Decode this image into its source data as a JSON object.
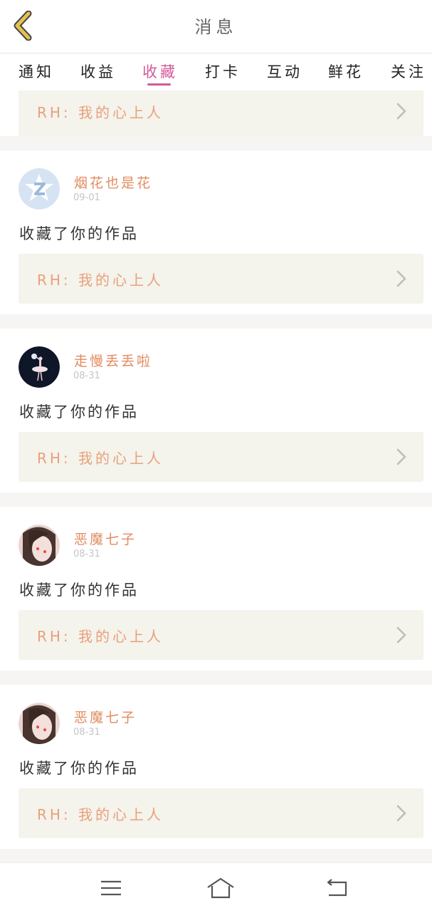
{
  "header": {
    "title": "消息",
    "back_icon": "back-chevron-icon"
  },
  "tabs": [
    {
      "label": "通知",
      "active": false
    },
    {
      "label": "收益",
      "active": false
    },
    {
      "label": "收藏",
      "active": true
    },
    {
      "label": "打卡",
      "active": false
    },
    {
      "label": "互动",
      "active": false
    },
    {
      "label": "鲜花",
      "active": false
    },
    {
      "label": "关注",
      "active": false
    }
  ],
  "colors": {
    "active_tab": "#d45a98",
    "username": "#e28b5f",
    "work_title": "#e9a07a",
    "back_icon": "#e4c250",
    "work_box_bg": "#f4f3ec"
  },
  "partial_item": {
    "work_title": "RH:  我的心上人"
  },
  "items": [
    {
      "username": "烟花也是花",
      "date": "09-01",
      "action": "收藏了你的作品",
      "work_title": "RH:  我的心上人",
      "avatar": "qq-default-avatar"
    },
    {
      "username": "走慢丢丢啦",
      "date": "08-31",
      "action": "收藏了你的作品",
      "work_title": "RH:  我的心上人",
      "avatar": "ballerina-avatar"
    },
    {
      "username": "恶魔七子",
      "date": "08-31",
      "action": "收藏了你的作品",
      "work_title": "RH:  我的心上人",
      "avatar": "girl-portrait-avatar"
    },
    {
      "username": "恶魔七子",
      "date": "08-31",
      "action": "收藏了你的作品",
      "work_title": "RH:  我的心上人",
      "avatar": "girl-portrait-avatar"
    }
  ],
  "navbar": {
    "icons": [
      "menu-icon",
      "home-icon",
      "back-icon"
    ]
  }
}
